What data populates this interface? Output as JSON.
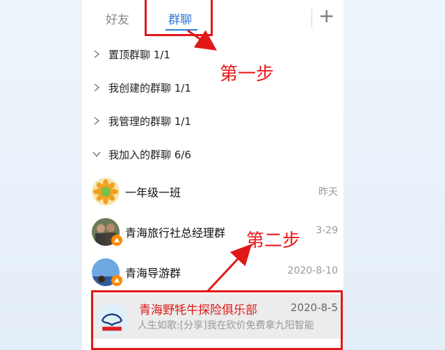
{
  "tabs": {
    "friends_label": "好友",
    "groups_label": "群聊",
    "add_label": "+"
  },
  "sections": [
    {
      "label": "置顶群聊 1/1",
      "expanded": false
    },
    {
      "label": "我创建的群聊 1/1",
      "expanded": false
    },
    {
      "label": "我管理的群聊 1/1",
      "expanded": false
    },
    {
      "label": "我加入的群聊 6/6",
      "expanded": true
    }
  ],
  "groups": [
    {
      "name": "一年级一班",
      "time": "昨天",
      "preview": "",
      "avatar": "flower-avatar"
    },
    {
      "name": "青海旅行社总经理群",
      "time": "3-29",
      "preview": "",
      "avatar": "people-avatar"
    },
    {
      "name": "青海导游群",
      "time": "2020-8-10",
      "preview": "",
      "avatar": "sky-avatar"
    },
    {
      "name": "青海野牦牛探险俱乐部",
      "time": "2020-8-5",
      "preview": "人生如歌:[分享]我在砍价免费拿九阳智能",
      "avatar": "yak-avatar"
    }
  ],
  "annotations": {
    "step1": "第一步",
    "step2": "第二步"
  },
  "colors": {
    "accent": "#2a78d6",
    "annotation": "#e01818"
  }
}
